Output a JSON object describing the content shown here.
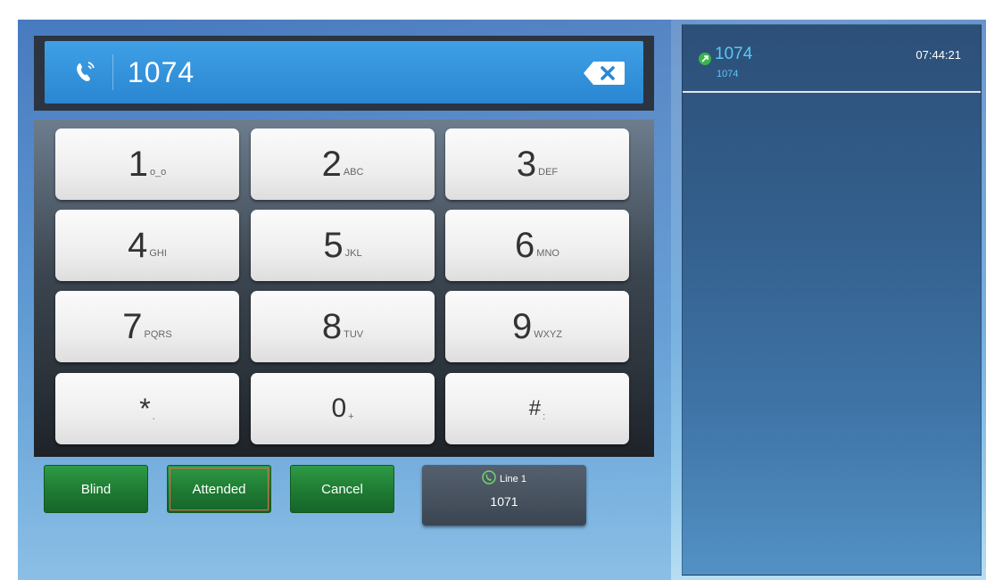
{
  "dialer": {
    "number": "1074"
  },
  "keypad": {
    "keys": [
      {
        "digit": "1",
        "sub": "o_o"
      },
      {
        "digit": "2",
        "sub": "ABC"
      },
      {
        "digit": "3",
        "sub": "DEF"
      },
      {
        "digit": "4",
        "sub": "GHI"
      },
      {
        "digit": "5",
        "sub": "JKL"
      },
      {
        "digit": "6",
        "sub": "MNO"
      },
      {
        "digit": "7",
        "sub": "PQRS"
      },
      {
        "digit": "8",
        "sub": "TUV"
      },
      {
        "digit": "9",
        "sub": "WXYZ"
      },
      {
        "digit": "*",
        "sub": "."
      },
      {
        "digit": "0",
        "sub": "+"
      },
      {
        "digit": "#",
        "sub": ":"
      }
    ]
  },
  "actions": {
    "blind": "Blind",
    "attended": "Attended",
    "cancel": "Cancel",
    "line_label": "Line 1",
    "line_number": "1071"
  },
  "call_list": {
    "items": [
      {
        "name": "1074",
        "number": "1074",
        "time": "07:44:21",
        "icon": "outgoing-call-icon"
      }
    ]
  },
  "colors": {
    "accent": "#5bc8f2",
    "button_green": "#1e7a32",
    "selected_outline": "#f06a4a"
  }
}
